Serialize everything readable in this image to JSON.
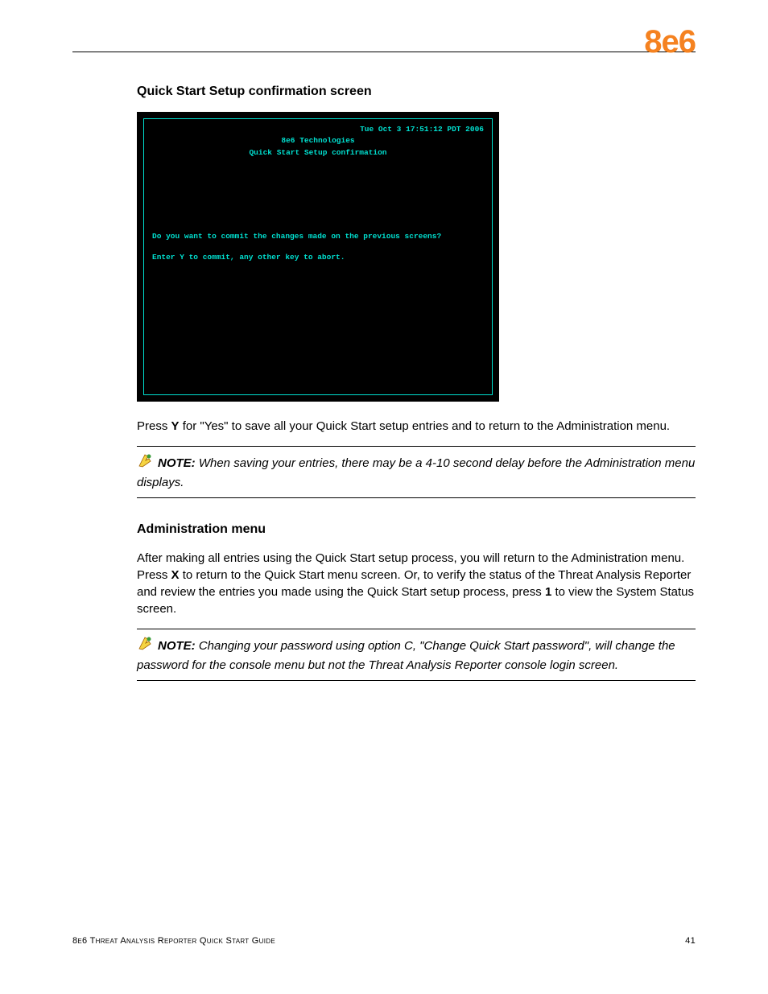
{
  "brand": {
    "logo_text": "8e6",
    "logo_color": "#f58220"
  },
  "section1": {
    "heading": "Quick Start Setup confirmation screen",
    "terminal": {
      "date_line": "Tue Oct  3 17:51:12 PDT 2006",
      "company": "8e6 Technologies",
      "subtitle": "Quick Start Setup confirmation",
      "prompt1": "Do you want to commit the changes made on the previous screens?",
      "prompt2": "Enter Y to commit, any other key to abort."
    },
    "body_pre": "Press ",
    "body_key": "Y",
    "body_post": " for \"Yes\" to save all your Quick Start setup entries and to return to the Administration menu.",
    "note_label": "NOTE:",
    "note_text": " When saving your entries, there may be a 4-10 second delay before the Administration menu displays."
  },
  "section2": {
    "heading": "Administration menu",
    "body_p1a": "After making all entries using the Quick Start setup process, you will return to the Administration menu. Press ",
    "body_p1_key1": "X",
    "body_p1b": " to return to the Quick Start menu screen. Or, to verify the status of the Threat Analysis Reporter and review the entries you made using the Quick Start setup process, press ",
    "body_p1_key2": "1",
    "body_p1c": " to view the System Status screen.",
    "note_label": "NOTE:",
    "note_text": " Changing your password using option C, \"Change Quick Start password\", will change the password for the console menu but not the Threat Analysis Reporter console login screen."
  },
  "footer": {
    "left": "8e6 Threat Analysis Reporter Quick Start Guide",
    "right": "41"
  }
}
